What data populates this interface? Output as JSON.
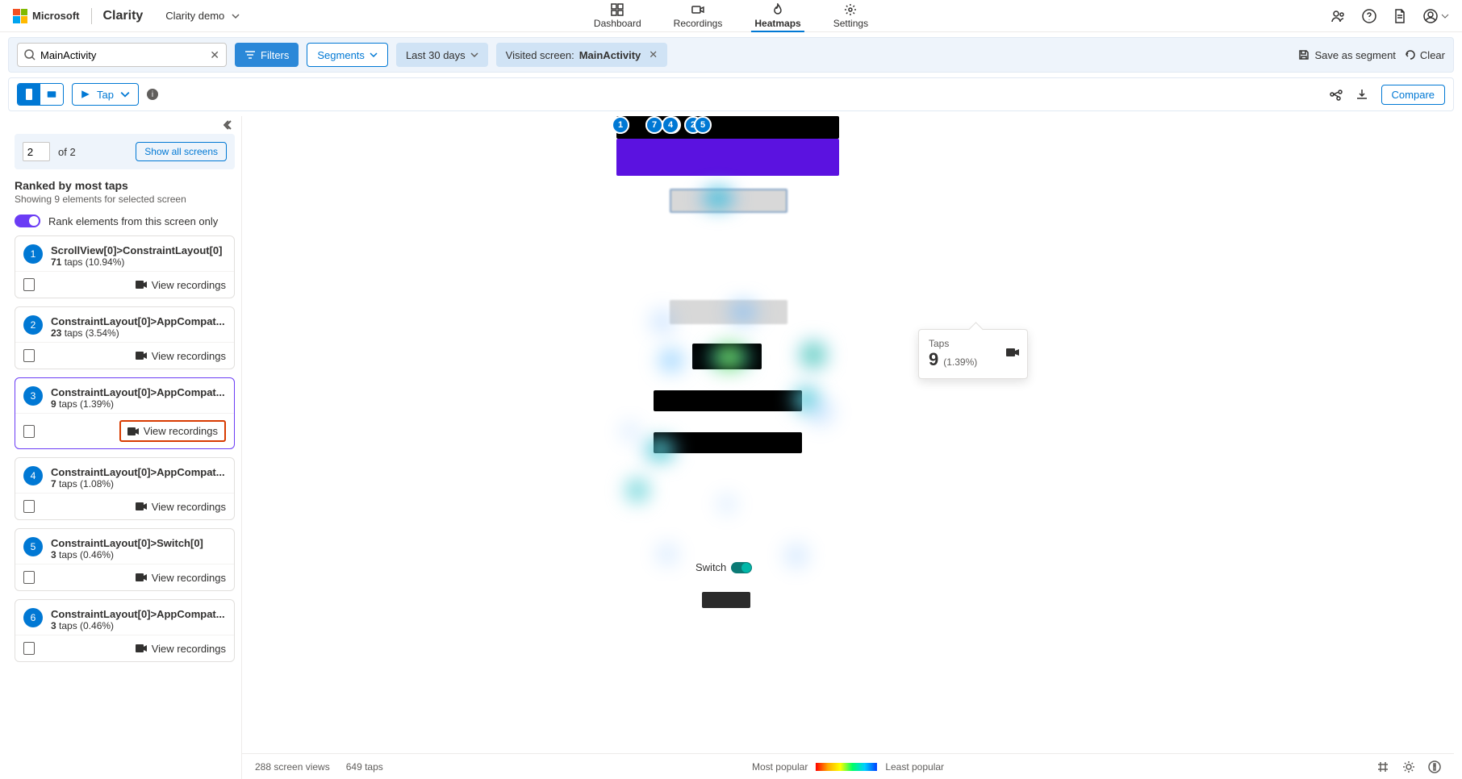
{
  "header": {
    "brand": "Microsoft",
    "product": "Clarity",
    "demo_label": "Clarity demo",
    "tabs": {
      "dashboard": "Dashboard",
      "recordings": "Recordings",
      "heatmaps": "Heatmaps",
      "settings": "Settings"
    }
  },
  "filters": {
    "search_value": "MainActivity",
    "filters_btn": "Filters",
    "segments_btn": "Segments",
    "date_label": "Last 30 days",
    "chip_prefix": "Visited screen: ",
    "chip_value": "MainActivity",
    "save_segment": "Save as segment",
    "clear": "Clear"
  },
  "toolbar": {
    "tap_label": "Tap",
    "compare": "Compare"
  },
  "sidebar": {
    "page_current": "2",
    "page_total": "of 2",
    "show_all": "Show all screens",
    "rank_title": "Ranked by most taps",
    "rank_sub": "Showing 9 elements for selected screen",
    "toggle_label": "Rank elements from this screen only",
    "view_recordings": "View recordings",
    "items": [
      {
        "n": "1",
        "name": "ScrollView[0]>ConstraintLayout[0]",
        "taps": "71",
        "pct": "(10.94%)"
      },
      {
        "n": "2",
        "name": "ConstraintLayout[0]>AppCompat...",
        "taps": "23",
        "pct": "(3.54%)"
      },
      {
        "n": "3",
        "name": "ConstraintLayout[0]>AppCompat...",
        "taps": "9",
        "pct": "(1.39%)"
      },
      {
        "n": "4",
        "name": "ConstraintLayout[0]>AppCompat...",
        "taps": "7",
        "pct": "(1.08%)"
      },
      {
        "n": "5",
        "name": "ConstraintLayout[0]>Switch[0]",
        "taps": "3",
        "pct": "(0.46%)"
      },
      {
        "n": "6",
        "name": "ConstraintLayout[0]>AppCompat...",
        "taps": "3",
        "pct": "(0.46%)"
      }
    ],
    "taps_word": "taps"
  },
  "tooltip": {
    "label": "Taps",
    "value": "9",
    "pct": "(1.39%)"
  },
  "canvas_switch": "Switch",
  "footer": {
    "views": "288 screen views",
    "taps": "649 taps",
    "most": "Most popular",
    "least": "Least popular"
  }
}
